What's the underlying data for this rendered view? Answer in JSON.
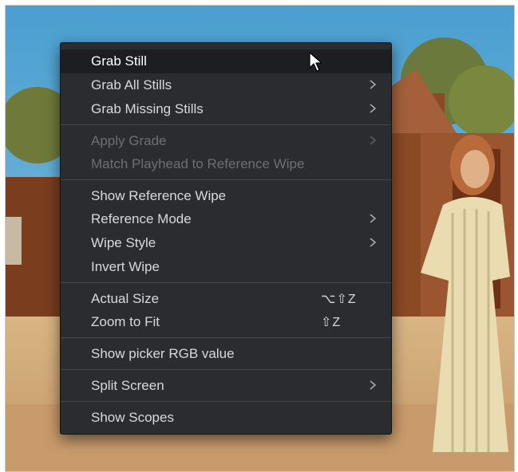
{
  "menu": {
    "grab_still": "Grab Still",
    "grab_all_stills": "Grab All Stills",
    "grab_missing_stills": "Grab Missing Stills",
    "apply_grade": "Apply Grade",
    "match_playhead": "Match Playhead to Reference Wipe",
    "show_reference_wipe": "Show Reference Wipe",
    "reference_mode": "Reference Mode",
    "wipe_style": "Wipe Style",
    "invert_wipe": "Invert Wipe",
    "actual_size": "Actual Size",
    "actual_size_shortcut": "⌥⇧Z",
    "zoom_to_fit": "Zoom to Fit",
    "zoom_to_fit_shortcut": "⇧Z",
    "show_picker_rgb": "Show picker RGB value",
    "split_screen": "Split Screen",
    "show_scopes": "Show Scopes"
  },
  "colors": {
    "menu_bg": "#2b2c30",
    "highlight_bg": "#1d1e21",
    "text": "#d9d9db",
    "disabled_text": "#6e6f74",
    "separator": "#46474c"
  },
  "icons": [
    "submenu-chevron-icon",
    "mouse-pointer-icon"
  ]
}
